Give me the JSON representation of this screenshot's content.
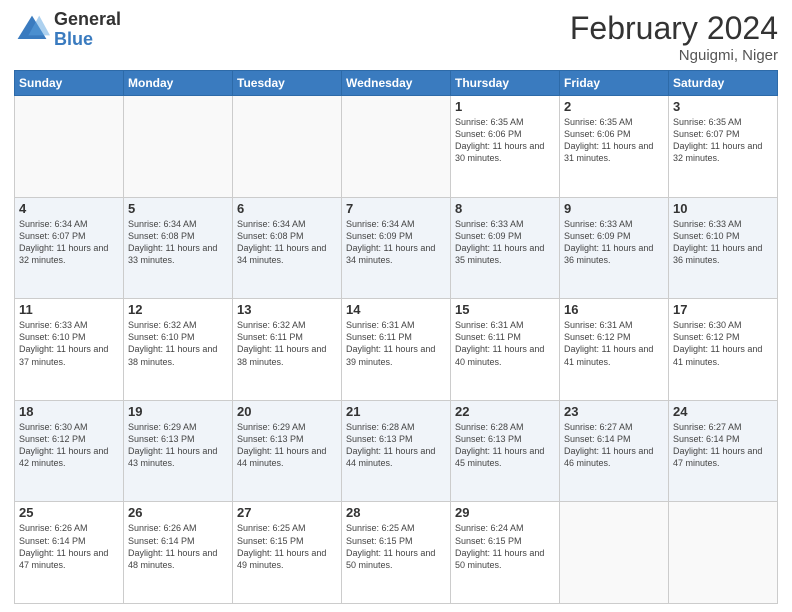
{
  "header": {
    "logo_general": "General",
    "logo_blue": "Blue",
    "month_title": "February 2024",
    "location": "Nguigmi, Niger"
  },
  "days_of_week": [
    "Sunday",
    "Monday",
    "Tuesday",
    "Wednesday",
    "Thursday",
    "Friday",
    "Saturday"
  ],
  "weeks": [
    [
      {
        "day": "",
        "info": ""
      },
      {
        "day": "",
        "info": ""
      },
      {
        "day": "",
        "info": ""
      },
      {
        "day": "",
        "info": ""
      },
      {
        "day": "1",
        "info": "Sunrise: 6:35 AM\nSunset: 6:06 PM\nDaylight: 11 hours and 30 minutes."
      },
      {
        "day": "2",
        "info": "Sunrise: 6:35 AM\nSunset: 6:06 PM\nDaylight: 11 hours and 31 minutes."
      },
      {
        "day": "3",
        "info": "Sunrise: 6:35 AM\nSunset: 6:07 PM\nDaylight: 11 hours and 32 minutes."
      }
    ],
    [
      {
        "day": "4",
        "info": "Sunrise: 6:34 AM\nSunset: 6:07 PM\nDaylight: 11 hours and 32 minutes."
      },
      {
        "day": "5",
        "info": "Sunrise: 6:34 AM\nSunset: 6:08 PM\nDaylight: 11 hours and 33 minutes."
      },
      {
        "day": "6",
        "info": "Sunrise: 6:34 AM\nSunset: 6:08 PM\nDaylight: 11 hours and 34 minutes."
      },
      {
        "day": "7",
        "info": "Sunrise: 6:34 AM\nSunset: 6:09 PM\nDaylight: 11 hours and 34 minutes."
      },
      {
        "day": "8",
        "info": "Sunrise: 6:33 AM\nSunset: 6:09 PM\nDaylight: 11 hours and 35 minutes."
      },
      {
        "day": "9",
        "info": "Sunrise: 6:33 AM\nSunset: 6:09 PM\nDaylight: 11 hours and 36 minutes."
      },
      {
        "day": "10",
        "info": "Sunrise: 6:33 AM\nSunset: 6:10 PM\nDaylight: 11 hours and 36 minutes."
      }
    ],
    [
      {
        "day": "11",
        "info": "Sunrise: 6:33 AM\nSunset: 6:10 PM\nDaylight: 11 hours and 37 minutes."
      },
      {
        "day": "12",
        "info": "Sunrise: 6:32 AM\nSunset: 6:10 PM\nDaylight: 11 hours and 38 minutes."
      },
      {
        "day": "13",
        "info": "Sunrise: 6:32 AM\nSunset: 6:11 PM\nDaylight: 11 hours and 38 minutes."
      },
      {
        "day": "14",
        "info": "Sunrise: 6:31 AM\nSunset: 6:11 PM\nDaylight: 11 hours and 39 minutes."
      },
      {
        "day": "15",
        "info": "Sunrise: 6:31 AM\nSunset: 6:11 PM\nDaylight: 11 hours and 40 minutes."
      },
      {
        "day": "16",
        "info": "Sunrise: 6:31 AM\nSunset: 6:12 PM\nDaylight: 11 hours and 41 minutes."
      },
      {
        "day": "17",
        "info": "Sunrise: 6:30 AM\nSunset: 6:12 PM\nDaylight: 11 hours and 41 minutes."
      }
    ],
    [
      {
        "day": "18",
        "info": "Sunrise: 6:30 AM\nSunset: 6:12 PM\nDaylight: 11 hours and 42 minutes."
      },
      {
        "day": "19",
        "info": "Sunrise: 6:29 AM\nSunset: 6:13 PM\nDaylight: 11 hours and 43 minutes."
      },
      {
        "day": "20",
        "info": "Sunrise: 6:29 AM\nSunset: 6:13 PM\nDaylight: 11 hours and 44 minutes."
      },
      {
        "day": "21",
        "info": "Sunrise: 6:28 AM\nSunset: 6:13 PM\nDaylight: 11 hours and 44 minutes."
      },
      {
        "day": "22",
        "info": "Sunrise: 6:28 AM\nSunset: 6:13 PM\nDaylight: 11 hours and 45 minutes."
      },
      {
        "day": "23",
        "info": "Sunrise: 6:27 AM\nSunset: 6:14 PM\nDaylight: 11 hours and 46 minutes."
      },
      {
        "day": "24",
        "info": "Sunrise: 6:27 AM\nSunset: 6:14 PM\nDaylight: 11 hours and 47 minutes."
      }
    ],
    [
      {
        "day": "25",
        "info": "Sunrise: 6:26 AM\nSunset: 6:14 PM\nDaylight: 11 hours and 47 minutes."
      },
      {
        "day": "26",
        "info": "Sunrise: 6:26 AM\nSunset: 6:14 PM\nDaylight: 11 hours and 48 minutes."
      },
      {
        "day": "27",
        "info": "Sunrise: 6:25 AM\nSunset: 6:15 PM\nDaylight: 11 hours and 49 minutes."
      },
      {
        "day": "28",
        "info": "Sunrise: 6:25 AM\nSunset: 6:15 PM\nDaylight: 11 hours and 50 minutes."
      },
      {
        "day": "29",
        "info": "Sunrise: 6:24 AM\nSunset: 6:15 PM\nDaylight: 11 hours and 50 minutes."
      },
      {
        "day": "",
        "info": ""
      },
      {
        "day": "",
        "info": ""
      }
    ]
  ]
}
